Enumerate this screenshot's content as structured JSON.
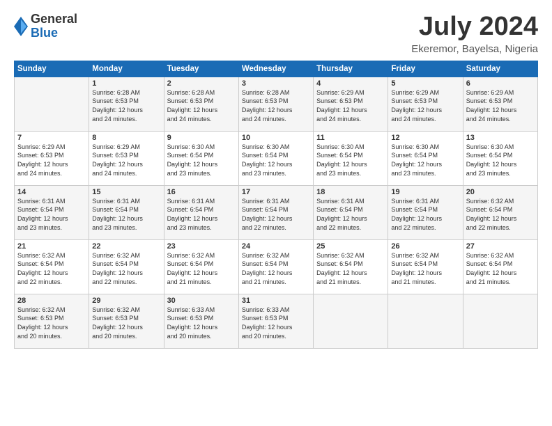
{
  "logo": {
    "general": "General",
    "blue": "Blue"
  },
  "title": "July 2024",
  "location": "Ekeremor, Bayelsa, Nigeria",
  "days_of_week": [
    "Sunday",
    "Monday",
    "Tuesday",
    "Wednesday",
    "Thursday",
    "Friday",
    "Saturday"
  ],
  "weeks": [
    [
      {
        "day": "",
        "info": ""
      },
      {
        "day": "1",
        "info": "Sunrise: 6:28 AM\nSunset: 6:53 PM\nDaylight: 12 hours\nand 24 minutes."
      },
      {
        "day": "2",
        "info": "Sunrise: 6:28 AM\nSunset: 6:53 PM\nDaylight: 12 hours\nand 24 minutes."
      },
      {
        "day": "3",
        "info": "Sunrise: 6:28 AM\nSunset: 6:53 PM\nDaylight: 12 hours\nand 24 minutes."
      },
      {
        "day": "4",
        "info": "Sunrise: 6:29 AM\nSunset: 6:53 PM\nDaylight: 12 hours\nand 24 minutes."
      },
      {
        "day": "5",
        "info": "Sunrise: 6:29 AM\nSunset: 6:53 PM\nDaylight: 12 hours\nand 24 minutes."
      },
      {
        "day": "6",
        "info": "Sunrise: 6:29 AM\nSunset: 6:53 PM\nDaylight: 12 hours\nand 24 minutes."
      }
    ],
    [
      {
        "day": "7",
        "info": "Sunrise: 6:29 AM\nSunset: 6:53 PM\nDaylight: 12 hours\nand 24 minutes."
      },
      {
        "day": "8",
        "info": "Sunrise: 6:29 AM\nSunset: 6:53 PM\nDaylight: 12 hours\nand 24 minutes."
      },
      {
        "day": "9",
        "info": "Sunrise: 6:30 AM\nSunset: 6:54 PM\nDaylight: 12 hours\nand 23 minutes."
      },
      {
        "day": "10",
        "info": "Sunrise: 6:30 AM\nSunset: 6:54 PM\nDaylight: 12 hours\nand 23 minutes."
      },
      {
        "day": "11",
        "info": "Sunrise: 6:30 AM\nSunset: 6:54 PM\nDaylight: 12 hours\nand 23 minutes."
      },
      {
        "day": "12",
        "info": "Sunrise: 6:30 AM\nSunset: 6:54 PM\nDaylight: 12 hours\nand 23 minutes."
      },
      {
        "day": "13",
        "info": "Sunrise: 6:30 AM\nSunset: 6:54 PM\nDaylight: 12 hours\nand 23 minutes."
      }
    ],
    [
      {
        "day": "14",
        "info": "Sunrise: 6:31 AM\nSunset: 6:54 PM\nDaylight: 12 hours\nand 23 minutes."
      },
      {
        "day": "15",
        "info": "Sunrise: 6:31 AM\nSunset: 6:54 PM\nDaylight: 12 hours\nand 23 minutes."
      },
      {
        "day": "16",
        "info": "Sunrise: 6:31 AM\nSunset: 6:54 PM\nDaylight: 12 hours\nand 23 minutes."
      },
      {
        "day": "17",
        "info": "Sunrise: 6:31 AM\nSunset: 6:54 PM\nDaylight: 12 hours\nand 22 minutes."
      },
      {
        "day": "18",
        "info": "Sunrise: 6:31 AM\nSunset: 6:54 PM\nDaylight: 12 hours\nand 22 minutes."
      },
      {
        "day": "19",
        "info": "Sunrise: 6:31 AM\nSunset: 6:54 PM\nDaylight: 12 hours\nand 22 minutes."
      },
      {
        "day": "20",
        "info": "Sunrise: 6:32 AM\nSunset: 6:54 PM\nDaylight: 12 hours\nand 22 minutes."
      }
    ],
    [
      {
        "day": "21",
        "info": "Sunrise: 6:32 AM\nSunset: 6:54 PM\nDaylight: 12 hours\nand 22 minutes."
      },
      {
        "day": "22",
        "info": "Sunrise: 6:32 AM\nSunset: 6:54 PM\nDaylight: 12 hours\nand 22 minutes."
      },
      {
        "day": "23",
        "info": "Sunrise: 6:32 AM\nSunset: 6:54 PM\nDaylight: 12 hours\nand 21 minutes."
      },
      {
        "day": "24",
        "info": "Sunrise: 6:32 AM\nSunset: 6:54 PM\nDaylight: 12 hours\nand 21 minutes."
      },
      {
        "day": "25",
        "info": "Sunrise: 6:32 AM\nSunset: 6:54 PM\nDaylight: 12 hours\nand 21 minutes."
      },
      {
        "day": "26",
        "info": "Sunrise: 6:32 AM\nSunset: 6:54 PM\nDaylight: 12 hours\nand 21 minutes."
      },
      {
        "day": "27",
        "info": "Sunrise: 6:32 AM\nSunset: 6:54 PM\nDaylight: 12 hours\nand 21 minutes."
      }
    ],
    [
      {
        "day": "28",
        "info": "Sunrise: 6:32 AM\nSunset: 6:53 PM\nDaylight: 12 hours\nand 20 minutes."
      },
      {
        "day": "29",
        "info": "Sunrise: 6:32 AM\nSunset: 6:53 PM\nDaylight: 12 hours\nand 20 minutes."
      },
      {
        "day": "30",
        "info": "Sunrise: 6:33 AM\nSunset: 6:53 PM\nDaylight: 12 hours\nand 20 minutes."
      },
      {
        "day": "31",
        "info": "Sunrise: 6:33 AM\nSunset: 6:53 PM\nDaylight: 12 hours\nand 20 minutes."
      },
      {
        "day": "",
        "info": ""
      },
      {
        "day": "",
        "info": ""
      },
      {
        "day": "",
        "info": ""
      }
    ]
  ]
}
